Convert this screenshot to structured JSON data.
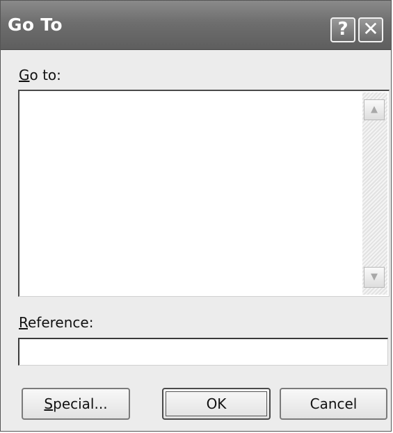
{
  "window": {
    "title": "Go To"
  },
  "title_buttons": {
    "help": "?",
    "close": "✕"
  },
  "goto_section": {
    "label_mnemonic": "G",
    "label_rest": "o to:"
  },
  "scrollbar": {
    "up_arrow": "▲",
    "down_arrow": "▼"
  },
  "reference_section": {
    "label_mnemonic": "R",
    "label_rest": "eference:",
    "value": ""
  },
  "buttons": {
    "special_mnemonic": "S",
    "special_rest": "pecial...",
    "ok": "OK",
    "cancel": "Cancel"
  }
}
